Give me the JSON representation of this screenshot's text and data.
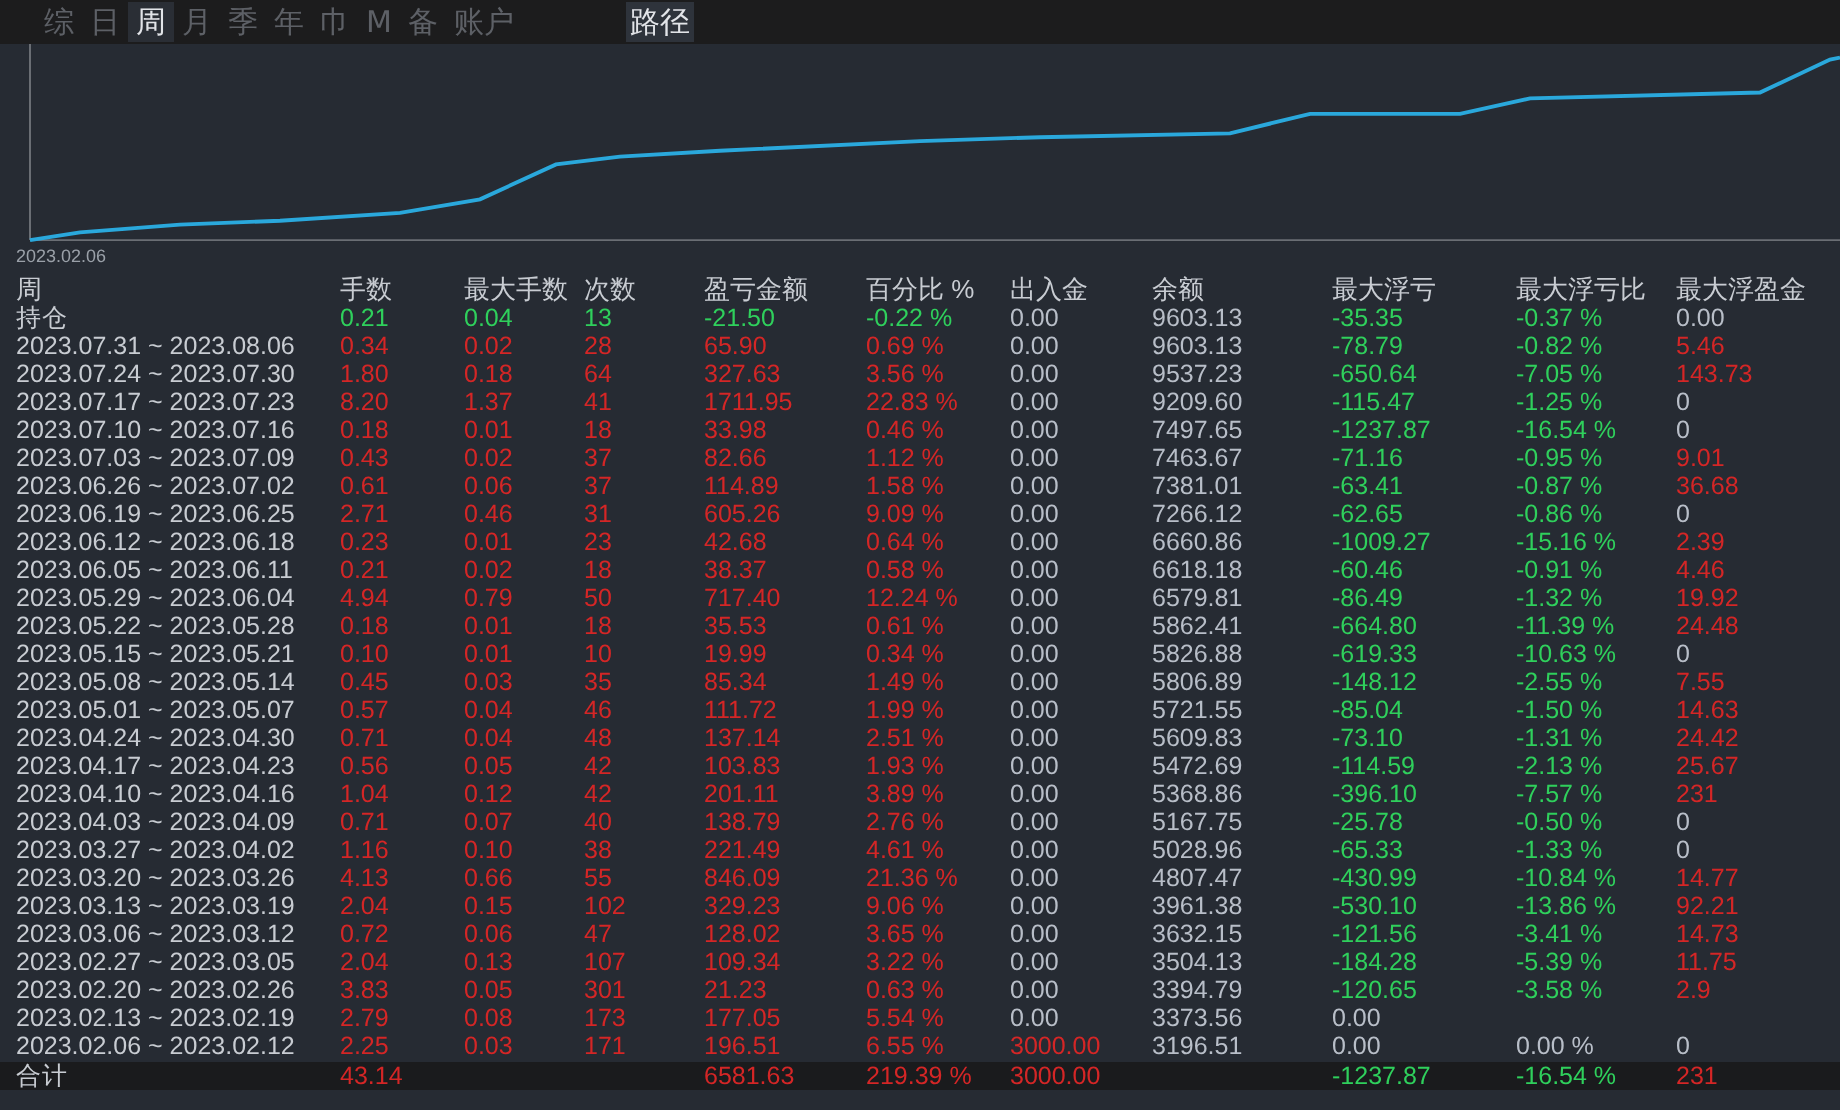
{
  "tabs": [
    {
      "label": "综",
      "selected": false
    },
    {
      "label": "日",
      "selected": false
    },
    {
      "label": "周",
      "selected": true
    },
    {
      "label": "月",
      "selected": false
    },
    {
      "label": "季",
      "selected": false
    },
    {
      "label": "年",
      "selected": false
    },
    {
      "label": "巾",
      "selected": false
    },
    {
      "label": "M",
      "selected": false
    },
    {
      "label": "备",
      "selected": false
    },
    {
      "label": "账户",
      "selected": false
    }
  ],
  "path_button": "路径",
  "chart": {
    "start_label": "2023.02.06"
  },
  "table": {
    "columns": [
      "周",
      "手数",
      "最大手数",
      "次数",
      "盈亏金额",
      "百分比 %",
      "出入金",
      "余额",
      "最大浮亏",
      "最大浮亏比",
      "最大浮盈金"
    ],
    "rows": [
      {
        "cells": [
          {
            "text": "持仓",
            "color": "#c8ccd2"
          },
          {
            "text": "0.21",
            "color": "#2fd05c"
          },
          {
            "text": "0.04",
            "color": "#2fd05c"
          },
          {
            "text": "13",
            "color": "#2fd05c"
          },
          {
            "text": "-21.50",
            "color": "#2fd05c"
          },
          {
            "text": "-0.22 %",
            "color": "#2fd05c"
          },
          {
            "text": "0.00",
            "color": "#b8bec8"
          },
          {
            "text": "9603.13",
            "color": "#b8bec8"
          },
          {
            "text": "-35.35",
            "color": "#2fd05c"
          },
          {
            "text": "-0.37 %",
            "color": "#2fd05c"
          },
          {
            "text": "0.00",
            "color": "#b8bec8"
          }
        ]
      },
      {
        "cells": [
          {
            "text": "2023.07.31 ~ 2023.08.06",
            "color": "#c8ccd2"
          },
          {
            "text": "0.34",
            "color": "#d42626"
          },
          {
            "text": "0.02",
            "color": "#d42626"
          },
          {
            "text": "28",
            "color": "#d42626"
          },
          {
            "text": "65.90",
            "color": "#d42626"
          },
          {
            "text": "0.69 %",
            "color": "#d42626"
          },
          {
            "text": "0.00",
            "color": "#b8bec8"
          },
          {
            "text": "9603.13",
            "color": "#b8bec8"
          },
          {
            "text": "-78.79",
            "color": "#2fd05c"
          },
          {
            "text": "-0.82 %",
            "color": "#2fd05c"
          },
          {
            "text": "5.46",
            "color": "#d42626"
          }
        ]
      },
      {
        "cells": [
          {
            "text": "2023.07.24 ~ 2023.07.30",
            "color": "#c8ccd2"
          },
          {
            "text": "1.80",
            "color": "#d42626"
          },
          {
            "text": "0.18",
            "color": "#d42626"
          },
          {
            "text": "64",
            "color": "#d42626"
          },
          {
            "text": "327.63",
            "color": "#d42626"
          },
          {
            "text": "3.56 %",
            "color": "#d42626"
          },
          {
            "text": "0.00",
            "color": "#b8bec8"
          },
          {
            "text": "9537.23",
            "color": "#b8bec8"
          },
          {
            "text": "-650.64",
            "color": "#2fd05c"
          },
          {
            "text": "-7.05 %",
            "color": "#2fd05c"
          },
          {
            "text": "143.73",
            "color": "#d42626"
          }
        ]
      },
      {
        "cells": [
          {
            "text": "2023.07.17 ~ 2023.07.23",
            "color": "#c8ccd2"
          },
          {
            "text": "8.20",
            "color": "#d42626"
          },
          {
            "text": "1.37",
            "color": "#d42626"
          },
          {
            "text": "41",
            "color": "#d42626"
          },
          {
            "text": "1711.95",
            "color": "#d42626"
          },
          {
            "text": "22.83 %",
            "color": "#d42626"
          },
          {
            "text": "0.00",
            "color": "#b8bec8"
          },
          {
            "text": "9209.60",
            "color": "#b8bec8"
          },
          {
            "text": "-115.47",
            "color": "#2fd05c"
          },
          {
            "text": "-1.25 %",
            "color": "#2fd05c"
          },
          {
            "text": "0",
            "color": "#b8bec8"
          }
        ]
      },
      {
        "cells": [
          {
            "text": "2023.07.10 ~ 2023.07.16",
            "color": "#c8ccd2"
          },
          {
            "text": "0.18",
            "color": "#d42626"
          },
          {
            "text": "0.01",
            "color": "#d42626"
          },
          {
            "text": "18",
            "color": "#d42626"
          },
          {
            "text": "33.98",
            "color": "#d42626"
          },
          {
            "text": "0.46 %",
            "color": "#d42626"
          },
          {
            "text": "0.00",
            "color": "#b8bec8"
          },
          {
            "text": "7497.65",
            "color": "#b8bec8"
          },
          {
            "text": "-1237.87",
            "color": "#2fd05c"
          },
          {
            "text": "-16.54 %",
            "color": "#2fd05c"
          },
          {
            "text": "0",
            "color": "#b8bec8"
          }
        ]
      },
      {
        "cells": [
          {
            "text": "2023.07.03 ~ 2023.07.09",
            "color": "#c8ccd2"
          },
          {
            "text": "0.43",
            "color": "#d42626"
          },
          {
            "text": "0.02",
            "color": "#d42626"
          },
          {
            "text": "37",
            "color": "#d42626"
          },
          {
            "text": "82.66",
            "color": "#d42626"
          },
          {
            "text": "1.12 %",
            "color": "#d42626"
          },
          {
            "text": "0.00",
            "color": "#b8bec8"
          },
          {
            "text": "7463.67",
            "color": "#b8bec8"
          },
          {
            "text": "-71.16",
            "color": "#2fd05c"
          },
          {
            "text": "-0.95 %",
            "color": "#2fd05c"
          },
          {
            "text": "9.01",
            "color": "#d42626"
          }
        ]
      },
      {
        "cells": [
          {
            "text": "2023.06.26 ~ 2023.07.02",
            "color": "#c8ccd2"
          },
          {
            "text": "0.61",
            "color": "#d42626"
          },
          {
            "text": "0.06",
            "color": "#d42626"
          },
          {
            "text": "37",
            "color": "#d42626"
          },
          {
            "text": "114.89",
            "color": "#d42626"
          },
          {
            "text": "1.58 %",
            "color": "#d42626"
          },
          {
            "text": "0.00",
            "color": "#b8bec8"
          },
          {
            "text": "7381.01",
            "color": "#b8bec8"
          },
          {
            "text": "-63.41",
            "color": "#2fd05c"
          },
          {
            "text": "-0.87 %",
            "color": "#2fd05c"
          },
          {
            "text": "36.68",
            "color": "#d42626"
          }
        ]
      },
      {
        "cells": [
          {
            "text": "2023.06.19 ~ 2023.06.25",
            "color": "#c8ccd2"
          },
          {
            "text": "2.71",
            "color": "#d42626"
          },
          {
            "text": "0.46",
            "color": "#d42626"
          },
          {
            "text": "31",
            "color": "#d42626"
          },
          {
            "text": "605.26",
            "color": "#d42626"
          },
          {
            "text": "9.09 %",
            "color": "#d42626"
          },
          {
            "text": "0.00",
            "color": "#b8bec8"
          },
          {
            "text": "7266.12",
            "color": "#b8bec8"
          },
          {
            "text": "-62.65",
            "color": "#2fd05c"
          },
          {
            "text": "-0.86 %",
            "color": "#2fd05c"
          },
          {
            "text": "0",
            "color": "#b8bec8"
          }
        ]
      },
      {
        "cells": [
          {
            "text": "2023.06.12 ~ 2023.06.18",
            "color": "#c8ccd2"
          },
          {
            "text": "0.23",
            "color": "#d42626"
          },
          {
            "text": "0.01",
            "color": "#d42626"
          },
          {
            "text": "23",
            "color": "#d42626"
          },
          {
            "text": "42.68",
            "color": "#d42626"
          },
          {
            "text": "0.64 %",
            "color": "#d42626"
          },
          {
            "text": "0.00",
            "color": "#b8bec8"
          },
          {
            "text": "6660.86",
            "color": "#b8bec8"
          },
          {
            "text": "-1009.27",
            "color": "#2fd05c"
          },
          {
            "text": "-15.16 %",
            "color": "#2fd05c"
          },
          {
            "text": "2.39",
            "color": "#d42626"
          }
        ]
      },
      {
        "cells": [
          {
            "text": "2023.06.05 ~ 2023.06.11",
            "color": "#c8ccd2"
          },
          {
            "text": "0.21",
            "color": "#d42626"
          },
          {
            "text": "0.02",
            "color": "#d42626"
          },
          {
            "text": "18",
            "color": "#d42626"
          },
          {
            "text": "38.37",
            "color": "#d42626"
          },
          {
            "text": "0.58 %",
            "color": "#d42626"
          },
          {
            "text": "0.00",
            "color": "#b8bec8"
          },
          {
            "text": "6618.18",
            "color": "#b8bec8"
          },
          {
            "text": "-60.46",
            "color": "#2fd05c"
          },
          {
            "text": "-0.91 %",
            "color": "#2fd05c"
          },
          {
            "text": "4.46",
            "color": "#d42626"
          }
        ]
      },
      {
        "cells": [
          {
            "text": "2023.05.29 ~ 2023.06.04",
            "color": "#c8ccd2"
          },
          {
            "text": "4.94",
            "color": "#d42626"
          },
          {
            "text": "0.79",
            "color": "#d42626"
          },
          {
            "text": "50",
            "color": "#d42626"
          },
          {
            "text": "717.40",
            "color": "#d42626"
          },
          {
            "text": "12.24 %",
            "color": "#d42626"
          },
          {
            "text": "0.00",
            "color": "#b8bec8"
          },
          {
            "text": "6579.81",
            "color": "#b8bec8"
          },
          {
            "text": "-86.49",
            "color": "#2fd05c"
          },
          {
            "text": "-1.32 %",
            "color": "#2fd05c"
          },
          {
            "text": "19.92",
            "color": "#d42626"
          }
        ]
      },
      {
        "cells": [
          {
            "text": "2023.05.22 ~ 2023.05.28",
            "color": "#c8ccd2"
          },
          {
            "text": "0.18",
            "color": "#d42626"
          },
          {
            "text": "0.01",
            "color": "#d42626"
          },
          {
            "text": "18",
            "color": "#d42626"
          },
          {
            "text": "35.53",
            "color": "#d42626"
          },
          {
            "text": "0.61 %",
            "color": "#d42626"
          },
          {
            "text": "0.00",
            "color": "#b8bec8"
          },
          {
            "text": "5862.41",
            "color": "#b8bec8"
          },
          {
            "text": "-664.80",
            "color": "#2fd05c"
          },
          {
            "text": "-11.39 %",
            "color": "#2fd05c"
          },
          {
            "text": "24.48",
            "color": "#d42626"
          }
        ]
      },
      {
        "cells": [
          {
            "text": "2023.05.15 ~ 2023.05.21",
            "color": "#c8ccd2"
          },
          {
            "text": "0.10",
            "color": "#d42626"
          },
          {
            "text": "0.01",
            "color": "#d42626"
          },
          {
            "text": "10",
            "color": "#d42626"
          },
          {
            "text": "19.99",
            "color": "#d42626"
          },
          {
            "text": "0.34 %",
            "color": "#d42626"
          },
          {
            "text": "0.00",
            "color": "#b8bec8"
          },
          {
            "text": "5826.88",
            "color": "#b8bec8"
          },
          {
            "text": "-619.33",
            "color": "#2fd05c"
          },
          {
            "text": "-10.63 %",
            "color": "#2fd05c"
          },
          {
            "text": "0",
            "color": "#b8bec8"
          }
        ]
      },
      {
        "cells": [
          {
            "text": "2023.05.08 ~ 2023.05.14",
            "color": "#c8ccd2"
          },
          {
            "text": "0.45",
            "color": "#d42626"
          },
          {
            "text": "0.03",
            "color": "#d42626"
          },
          {
            "text": "35",
            "color": "#d42626"
          },
          {
            "text": "85.34",
            "color": "#d42626"
          },
          {
            "text": "1.49 %",
            "color": "#d42626"
          },
          {
            "text": "0.00",
            "color": "#b8bec8"
          },
          {
            "text": "5806.89",
            "color": "#b8bec8"
          },
          {
            "text": "-148.12",
            "color": "#2fd05c"
          },
          {
            "text": "-2.55 %",
            "color": "#2fd05c"
          },
          {
            "text": "7.55",
            "color": "#d42626"
          }
        ]
      },
      {
        "cells": [
          {
            "text": "2023.05.01 ~ 2023.05.07",
            "color": "#c8ccd2"
          },
          {
            "text": "0.57",
            "color": "#d42626"
          },
          {
            "text": "0.04",
            "color": "#d42626"
          },
          {
            "text": "46",
            "color": "#d42626"
          },
          {
            "text": "111.72",
            "color": "#d42626"
          },
          {
            "text": "1.99 %",
            "color": "#d42626"
          },
          {
            "text": "0.00",
            "color": "#b8bec8"
          },
          {
            "text": "5721.55",
            "color": "#b8bec8"
          },
          {
            "text": "-85.04",
            "color": "#2fd05c"
          },
          {
            "text": "-1.50 %",
            "color": "#2fd05c"
          },
          {
            "text": "14.63",
            "color": "#d42626"
          }
        ]
      },
      {
        "cells": [
          {
            "text": "2023.04.24 ~ 2023.04.30",
            "color": "#c8ccd2"
          },
          {
            "text": "0.71",
            "color": "#d42626"
          },
          {
            "text": "0.04",
            "color": "#d42626"
          },
          {
            "text": "48",
            "color": "#d42626"
          },
          {
            "text": "137.14",
            "color": "#d42626"
          },
          {
            "text": "2.51 %",
            "color": "#d42626"
          },
          {
            "text": "0.00",
            "color": "#b8bec8"
          },
          {
            "text": "5609.83",
            "color": "#b8bec8"
          },
          {
            "text": "-73.10",
            "color": "#2fd05c"
          },
          {
            "text": "-1.31 %",
            "color": "#2fd05c"
          },
          {
            "text": "24.42",
            "color": "#d42626"
          }
        ]
      },
      {
        "cells": [
          {
            "text": "2023.04.17 ~ 2023.04.23",
            "color": "#c8ccd2"
          },
          {
            "text": "0.56",
            "color": "#d42626"
          },
          {
            "text": "0.05",
            "color": "#d42626"
          },
          {
            "text": "42",
            "color": "#d42626"
          },
          {
            "text": "103.83",
            "color": "#d42626"
          },
          {
            "text": "1.93 %",
            "color": "#d42626"
          },
          {
            "text": "0.00",
            "color": "#b8bec8"
          },
          {
            "text": "5472.69",
            "color": "#b8bec8"
          },
          {
            "text": "-114.59",
            "color": "#2fd05c"
          },
          {
            "text": "-2.13 %",
            "color": "#2fd05c"
          },
          {
            "text": "25.67",
            "color": "#d42626"
          }
        ]
      },
      {
        "cells": [
          {
            "text": "2023.04.10 ~ 2023.04.16",
            "color": "#c8ccd2"
          },
          {
            "text": "1.04",
            "color": "#d42626"
          },
          {
            "text": "0.12",
            "color": "#d42626"
          },
          {
            "text": "42",
            "color": "#d42626"
          },
          {
            "text": "201.11",
            "color": "#d42626"
          },
          {
            "text": "3.89 %",
            "color": "#d42626"
          },
          {
            "text": "0.00",
            "color": "#b8bec8"
          },
          {
            "text": "5368.86",
            "color": "#b8bec8"
          },
          {
            "text": "-396.10",
            "color": "#2fd05c"
          },
          {
            "text": "-7.57 %",
            "color": "#2fd05c"
          },
          {
            "text": "231",
            "color": "#d42626"
          }
        ]
      },
      {
        "cells": [
          {
            "text": "2023.04.03 ~ 2023.04.09",
            "color": "#c8ccd2"
          },
          {
            "text": "0.71",
            "color": "#d42626"
          },
          {
            "text": "0.07",
            "color": "#d42626"
          },
          {
            "text": "40",
            "color": "#d42626"
          },
          {
            "text": "138.79",
            "color": "#d42626"
          },
          {
            "text": "2.76 %",
            "color": "#d42626"
          },
          {
            "text": "0.00",
            "color": "#b8bec8"
          },
          {
            "text": "5167.75",
            "color": "#b8bec8"
          },
          {
            "text": "-25.78",
            "color": "#2fd05c"
          },
          {
            "text": "-0.50 %",
            "color": "#2fd05c"
          },
          {
            "text": "0",
            "color": "#b8bec8"
          }
        ]
      },
      {
        "cells": [
          {
            "text": "2023.03.27 ~ 2023.04.02",
            "color": "#c8ccd2"
          },
          {
            "text": "1.16",
            "color": "#d42626"
          },
          {
            "text": "0.10",
            "color": "#d42626"
          },
          {
            "text": "38",
            "color": "#d42626"
          },
          {
            "text": "221.49",
            "color": "#d42626"
          },
          {
            "text": "4.61 %",
            "color": "#d42626"
          },
          {
            "text": "0.00",
            "color": "#b8bec8"
          },
          {
            "text": "5028.96",
            "color": "#b8bec8"
          },
          {
            "text": "-65.33",
            "color": "#2fd05c"
          },
          {
            "text": "-1.33 %",
            "color": "#2fd05c"
          },
          {
            "text": "0",
            "color": "#b8bec8"
          }
        ]
      },
      {
        "cells": [
          {
            "text": "2023.03.20 ~ 2023.03.26",
            "color": "#c8ccd2"
          },
          {
            "text": "4.13",
            "color": "#d42626"
          },
          {
            "text": "0.66",
            "color": "#d42626"
          },
          {
            "text": "55",
            "color": "#d42626"
          },
          {
            "text": "846.09",
            "color": "#d42626"
          },
          {
            "text": "21.36 %",
            "color": "#d42626"
          },
          {
            "text": "0.00",
            "color": "#b8bec8"
          },
          {
            "text": "4807.47",
            "color": "#b8bec8"
          },
          {
            "text": "-430.99",
            "color": "#2fd05c"
          },
          {
            "text": "-10.84 %",
            "color": "#2fd05c"
          },
          {
            "text": "14.77",
            "color": "#d42626"
          }
        ]
      },
      {
        "cells": [
          {
            "text": "2023.03.13 ~ 2023.03.19",
            "color": "#c8ccd2"
          },
          {
            "text": "2.04",
            "color": "#d42626"
          },
          {
            "text": "0.15",
            "color": "#d42626"
          },
          {
            "text": "102",
            "color": "#d42626"
          },
          {
            "text": "329.23",
            "color": "#d42626"
          },
          {
            "text": "9.06 %",
            "color": "#d42626"
          },
          {
            "text": "0.00",
            "color": "#b8bec8"
          },
          {
            "text": "3961.38",
            "color": "#b8bec8"
          },
          {
            "text": "-530.10",
            "color": "#2fd05c"
          },
          {
            "text": "-13.86 %",
            "color": "#2fd05c"
          },
          {
            "text": "92.21",
            "color": "#d42626"
          }
        ]
      },
      {
        "cells": [
          {
            "text": "2023.03.06 ~ 2023.03.12",
            "color": "#c8ccd2"
          },
          {
            "text": "0.72",
            "color": "#d42626"
          },
          {
            "text": "0.06",
            "color": "#d42626"
          },
          {
            "text": "47",
            "color": "#d42626"
          },
          {
            "text": "128.02",
            "color": "#d42626"
          },
          {
            "text": "3.65 %",
            "color": "#d42626"
          },
          {
            "text": "0.00",
            "color": "#b8bec8"
          },
          {
            "text": "3632.15",
            "color": "#b8bec8"
          },
          {
            "text": "-121.56",
            "color": "#2fd05c"
          },
          {
            "text": "-3.41 %",
            "color": "#2fd05c"
          },
          {
            "text": "14.73",
            "color": "#d42626"
          }
        ]
      },
      {
        "cells": [
          {
            "text": "2023.02.27 ~ 2023.03.05",
            "color": "#c8ccd2"
          },
          {
            "text": "2.04",
            "color": "#d42626"
          },
          {
            "text": "0.13",
            "color": "#d42626"
          },
          {
            "text": "107",
            "color": "#d42626"
          },
          {
            "text": "109.34",
            "color": "#d42626"
          },
          {
            "text": "3.22 %",
            "color": "#d42626"
          },
          {
            "text": "0.00",
            "color": "#b8bec8"
          },
          {
            "text": "3504.13",
            "color": "#b8bec8"
          },
          {
            "text": "-184.28",
            "color": "#2fd05c"
          },
          {
            "text": "-5.39 %",
            "color": "#2fd05c"
          },
          {
            "text": "11.75",
            "color": "#d42626"
          }
        ]
      },
      {
        "cells": [
          {
            "text": "2023.02.20 ~ 2023.02.26",
            "color": "#c8ccd2"
          },
          {
            "text": "3.83",
            "color": "#d42626"
          },
          {
            "text": "0.05",
            "color": "#d42626"
          },
          {
            "text": "301",
            "color": "#d42626"
          },
          {
            "text": "21.23",
            "color": "#d42626"
          },
          {
            "text": "0.63 %",
            "color": "#d42626"
          },
          {
            "text": "0.00",
            "color": "#b8bec8"
          },
          {
            "text": "3394.79",
            "color": "#b8bec8"
          },
          {
            "text": "-120.65",
            "color": "#2fd05c"
          },
          {
            "text": "-3.58 %",
            "color": "#2fd05c"
          },
          {
            "text": "2.9",
            "color": "#d42626"
          }
        ]
      },
      {
        "cells": [
          {
            "text": "2023.02.13 ~ 2023.02.19",
            "color": "#c8ccd2"
          },
          {
            "text": "2.79",
            "color": "#d42626"
          },
          {
            "text": "0.08",
            "color": "#d42626"
          },
          {
            "text": "173",
            "color": "#d42626"
          },
          {
            "text": "177.05",
            "color": "#d42626"
          },
          {
            "text": "5.54 %",
            "color": "#d42626"
          },
          {
            "text": "0.00",
            "color": "#b8bec8"
          },
          {
            "text": "3373.56",
            "color": "#b8bec8"
          },
          {
            "text": "0.00",
            "color": "#b8bec8"
          }
        ]
      },
      {
        "cells": [
          {
            "text": "2023.02.06 ~ 2023.02.12",
            "color": "#c8ccd2"
          },
          {
            "text": "2.25",
            "color": "#d42626"
          },
          {
            "text": "0.03",
            "color": "#d42626"
          },
          {
            "text": "171",
            "color": "#d42626"
          },
          {
            "text": "196.51",
            "color": "#d42626"
          },
          {
            "text": "6.55 %",
            "color": "#d42626"
          },
          {
            "text": "3000.00",
            "color": "#d42626"
          },
          {
            "text": "3196.51",
            "color": "#b8bec8"
          },
          {
            "text": "0.00",
            "color": "#b8bec8"
          },
          {
            "text": "0.00 %",
            "color": "#b8bec8"
          },
          {
            "text": "0",
            "color": "#b8bec8"
          }
        ]
      }
    ],
    "total": {
      "cells": [
        {
          "text": "合计",
          "color": "#c8ccd2"
        },
        {
          "text": "43.14",
          "color": "#d42626"
        },
        null,
        null,
        {
          "text": "6581.63",
          "color": "#d42626"
        },
        {
          "text": "219.39 %",
          "color": "#d42626"
        },
        {
          "text": "3000.00",
          "color": "#d42626"
        },
        null,
        {
          "text": "-1237.87",
          "color": "#2fd05c"
        },
        {
          "text": "-16.54 %",
          "color": "#2fd05c"
        },
        {
          "text": "231",
          "color": "#d42626"
        }
      ]
    }
  }
}
